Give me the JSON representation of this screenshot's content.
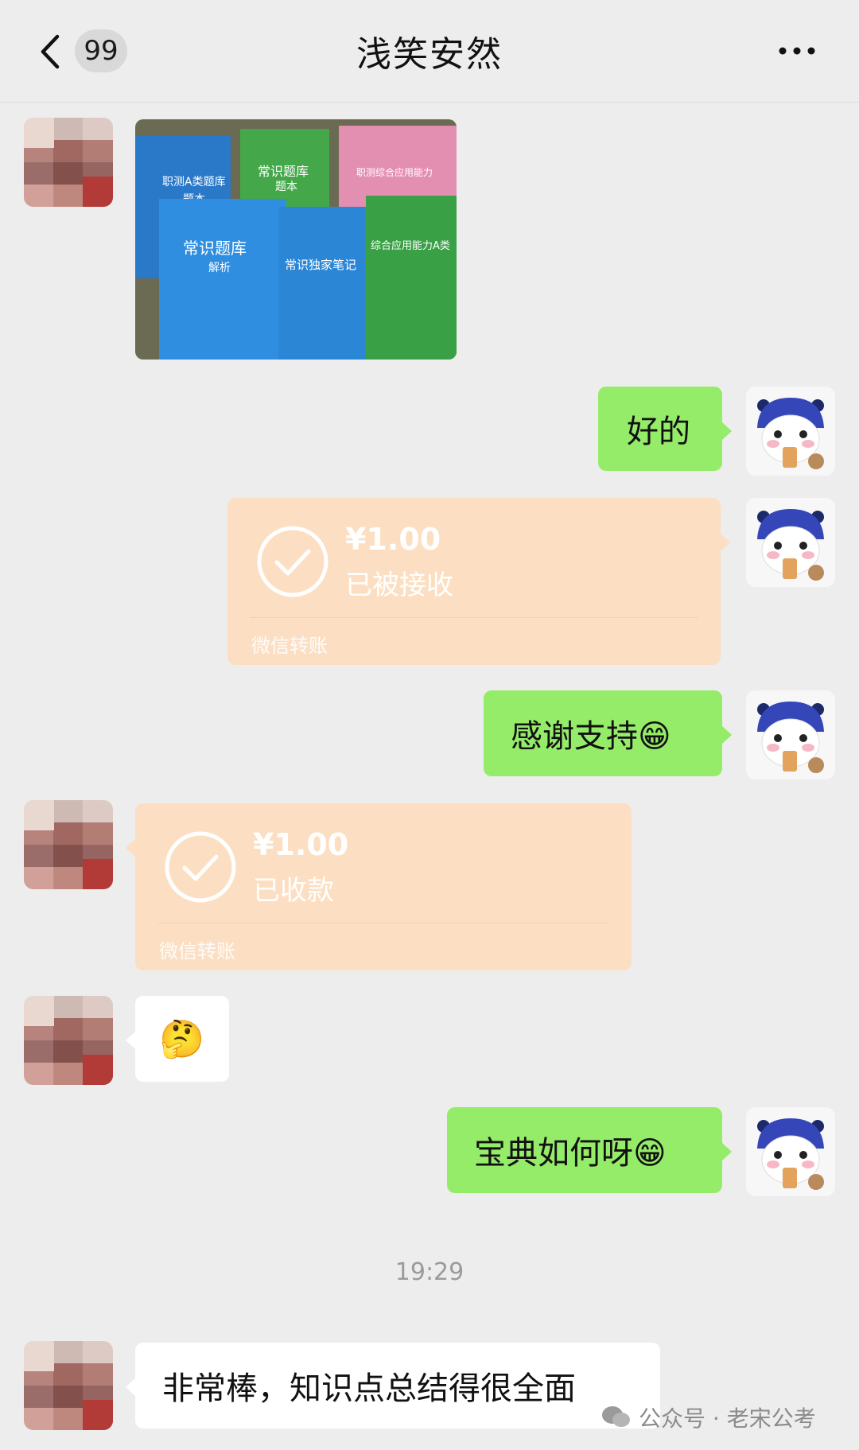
{
  "header": {
    "unread_count": "99",
    "title": "浅笑安然"
  },
  "photo": {
    "books": [
      {
        "title": "职测A类题库",
        "sub": "题本",
        "color": "#2a79c9"
      },
      {
        "title": "常识题库",
        "sub": "题本",
        "color": "#44a84a"
      },
      {
        "title": "职测综合应用能力",
        "sub": "",
        "color": "#e38fb2"
      },
      {
        "title": "常识题库",
        "sub": "解析",
        "color": "#2f8ee0"
      },
      {
        "title": "常识独家笔记",
        "sub": "",
        "color": "#2c86d6"
      },
      {
        "title": "综合应用能力A类",
        "sub": "",
        "color": "#3aa046"
      }
    ],
    "brand": "老宋公考"
  },
  "messages": {
    "m1_text": "好的",
    "transfer1": {
      "amount": "¥1.00",
      "status": "已被接收",
      "footer": "微信转账"
    },
    "m3_text": "感谢支持😁",
    "transfer2": {
      "amount": "¥1.00",
      "status": "已收款",
      "footer": "微信转账"
    },
    "m5_emoji": "🤔",
    "m6_text": "宝典如何呀😁",
    "timestamp": "19:29",
    "m7_text": "非常棒，知识点总结得很全面"
  },
  "watermark": {
    "text": "公众号 · 老宋公考"
  },
  "colors": {
    "bubble_green": "#95ec69",
    "transfer_bg": "#fcdfc2",
    "background": "#ededed"
  }
}
